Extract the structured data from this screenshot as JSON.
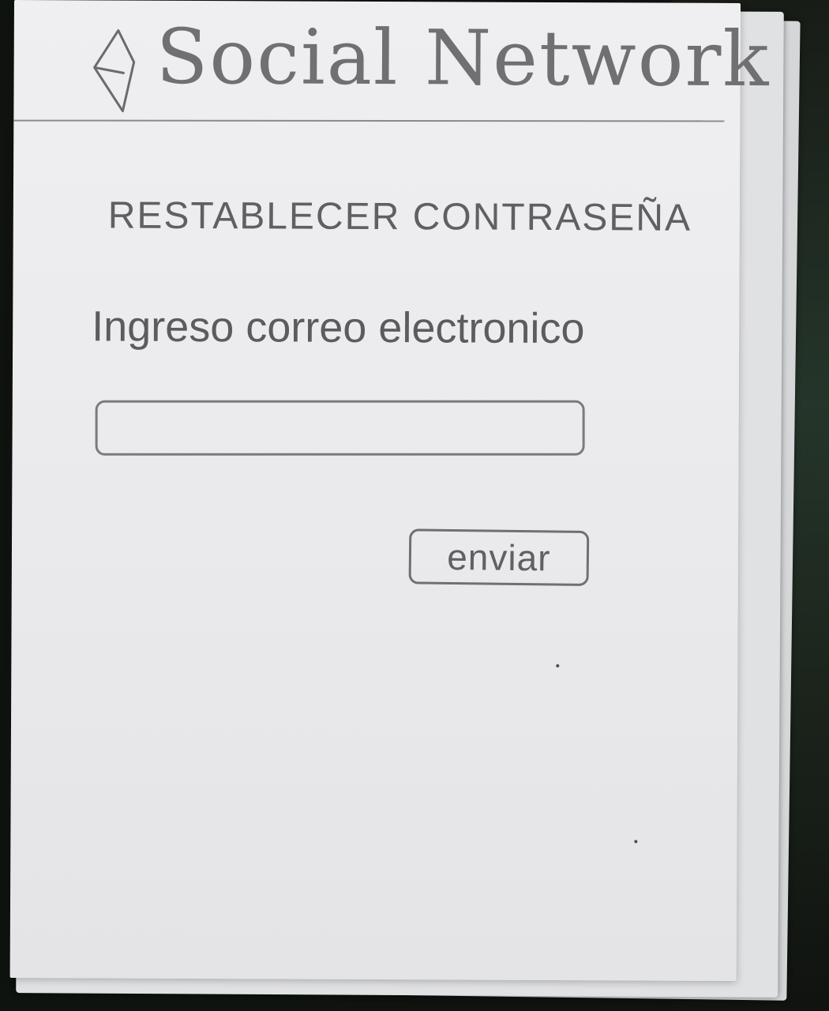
{
  "header": {
    "app_title": "Social Network",
    "back_icon": "back-arrow-icon"
  },
  "reset_form": {
    "title": "RESTABLECER CONTRASEÑA",
    "email_label": "Ingreso correo electronico",
    "email_value": "",
    "submit_label": "enviar"
  },
  "colors": {
    "ink": "#606064",
    "paper": "#ececee",
    "background": "#0f130f"
  }
}
